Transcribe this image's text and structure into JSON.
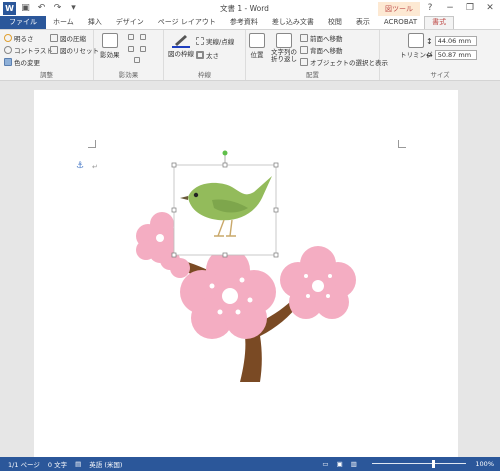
{
  "window": {
    "title": "文書 1 - Word",
    "context_tab_label": "図ツール",
    "minimize": "−",
    "restore": "❐",
    "close": "✕",
    "help": "?"
  },
  "tabs": [
    {
      "label": "ファイル"
    },
    {
      "label": "ホーム"
    },
    {
      "label": "挿入"
    },
    {
      "label": "デザイン"
    },
    {
      "label": "ページ レイアウト"
    },
    {
      "label": "参考資料"
    },
    {
      "label": "差し込み文書"
    },
    {
      "label": "校閲"
    },
    {
      "label": "表示"
    },
    {
      "label": "ACROBAT"
    },
    {
      "label": "書式"
    }
  ],
  "ribbon": {
    "adjust": {
      "label": "調整",
      "brightness": "明るさ",
      "contrast": "コントラスト",
      "recolor": "色の変更",
      "compress": "図の圧縮",
      "reset": "図のリセット"
    },
    "effects": {
      "label": "影効果",
      "shadow_button": "影効果"
    },
    "border": {
      "label": "枠線",
      "border_button": "図の枠線",
      "dash": "実線/点線",
      "weight": "太さ"
    },
    "arrange": {
      "label": "配置",
      "position": "位置",
      "wrap_text": "文字列の折り返し",
      "bring_forward": "前面へ移動",
      "send_backward": "背面へ移動",
      "selection_pane": "オブジェクトの選択と表示"
    },
    "size": {
      "label": "サイズ",
      "crop": "トリミング",
      "height": "44.06 mm",
      "width": "50.87 mm"
    }
  },
  "statusbar": {
    "page": "1/1 ページ",
    "words": "0 文字",
    "language": "英語 (米国)",
    "zoom": "100%"
  },
  "colors": {
    "word_blue": "#2b579a",
    "ribbon_bg": "#f3f3f3",
    "blossom_pink": "#f4adc2",
    "branch_brown": "#7a4a24",
    "bird_green": "#93bb5b"
  }
}
